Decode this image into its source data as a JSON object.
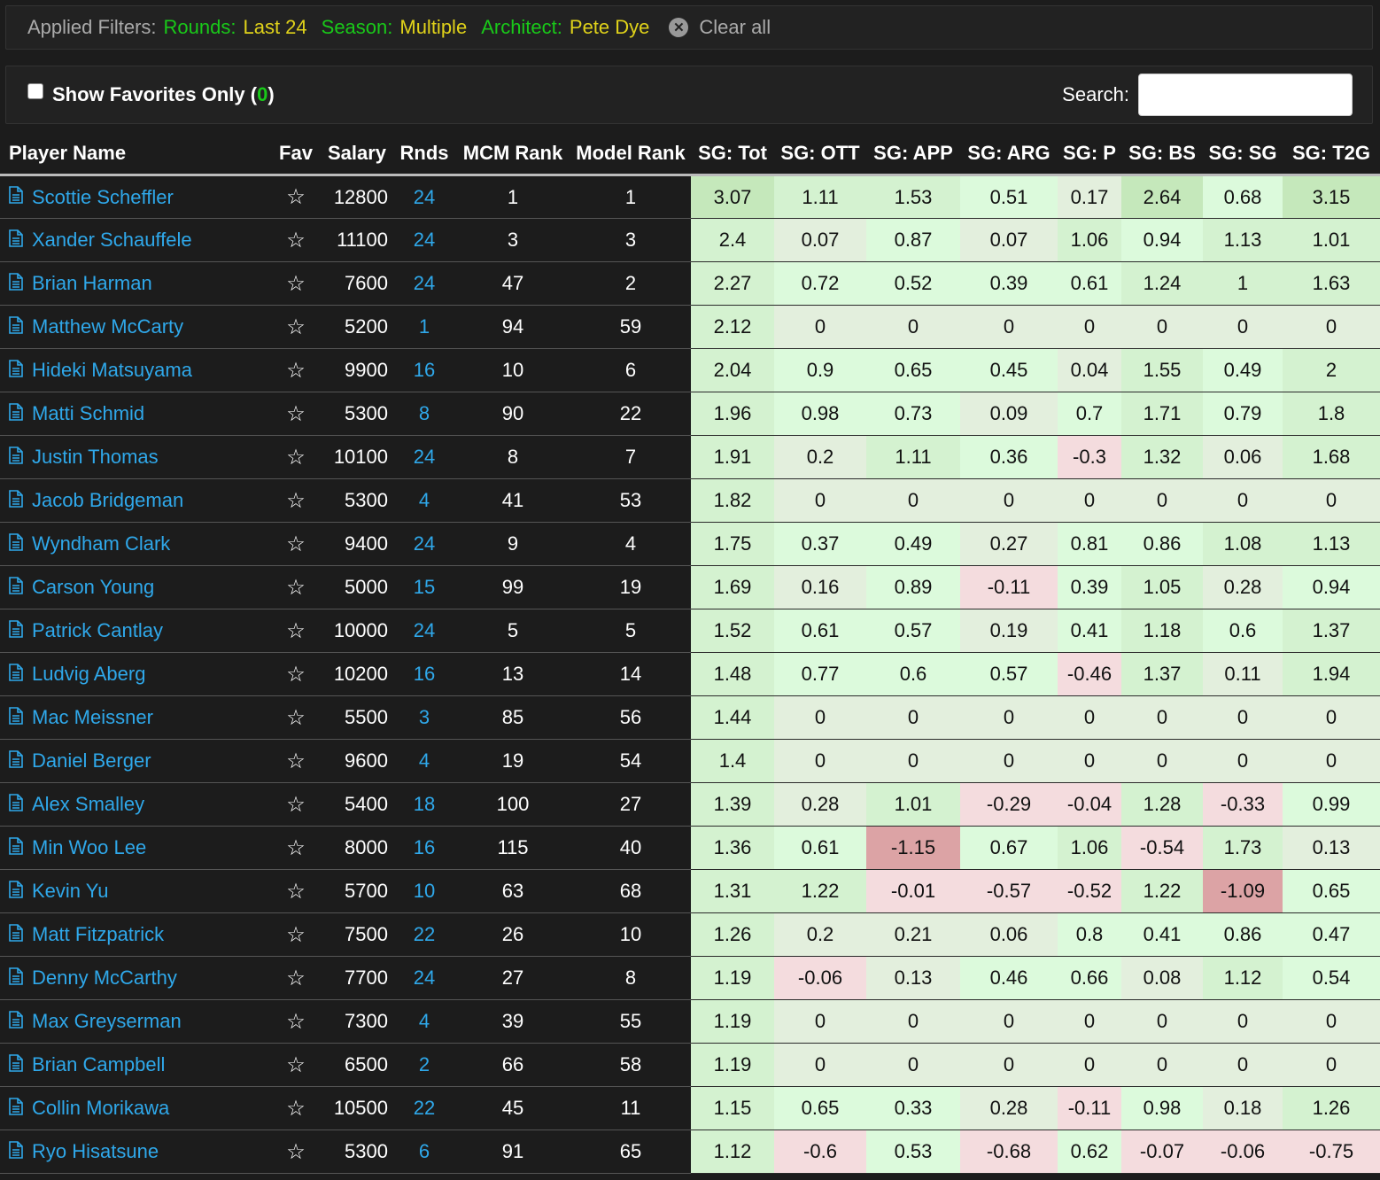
{
  "filters": {
    "label": "Applied Filters:",
    "items": [
      {
        "key": "Rounds:",
        "value": "Last 24"
      },
      {
        "key": "Season:",
        "value": "Multiple"
      },
      {
        "key": "Architect:",
        "value": "Pete Dye"
      }
    ],
    "clear_label": "Clear all"
  },
  "controls": {
    "favorites_label": "Show Favorites Only",
    "favorites_open": "(",
    "favorites_count": "0",
    "favorites_close": ")",
    "search_label": "Search:",
    "search_value": ""
  },
  "columns": [
    "Player Name",
    "Fav",
    "Salary",
    "Rnds",
    "MCM Rank",
    "Model Rank",
    "SG: Tot",
    "SG: OTT",
    "SG: APP",
    "SG: ARG",
    "SG: P",
    "SG: BS",
    "SG: SG",
    "SG: T2G"
  ],
  "icons": {
    "row_doc": "document-icon",
    "favorite": "star-outline-icon",
    "clear": "close-circle-icon"
  },
  "colors": {
    "link_blue": "#2fa8ea",
    "filter_key_green": "#19c919",
    "filter_value_yellow": "#e0d21a",
    "cell_strong_green": "#c5e8bb",
    "cell_mid_green": "#d4f2d0",
    "cell_light_green": "#dcfadc",
    "cell_neutral": "#e3efdd",
    "cell_light_red": "#f4dcde",
    "cell_strong_red": "#dca3a5"
  },
  "rows": [
    {
      "name": "Scottie Scheffler",
      "salary": "12800",
      "rnds": "24",
      "mcm": "1",
      "model": "1",
      "sg": [
        "3.07",
        "1.11",
        "1.53",
        "0.51",
        "0.17",
        "2.64",
        "0.68",
        "3.15"
      ]
    },
    {
      "name": "Xander Schauffele",
      "salary": "11100",
      "rnds": "24",
      "mcm": "3",
      "model": "3",
      "sg": [
        "2.4",
        "0.07",
        "0.87",
        "0.07",
        "1.06",
        "0.94",
        "1.13",
        "1.01"
      ]
    },
    {
      "name": "Brian Harman",
      "salary": "7600",
      "rnds": "24",
      "mcm": "47",
      "model": "2",
      "sg": [
        "2.27",
        "0.72",
        "0.52",
        "0.39",
        "0.61",
        "1.24",
        "1",
        "1.63"
      ]
    },
    {
      "name": "Matthew McCarty",
      "salary": "5200",
      "rnds": "1",
      "mcm": "94",
      "model": "59",
      "sg": [
        "2.12",
        "0",
        "0",
        "0",
        "0",
        "0",
        "0",
        "0"
      ]
    },
    {
      "name": "Hideki Matsuyama",
      "salary": "9900",
      "rnds": "16",
      "mcm": "10",
      "model": "6",
      "sg": [
        "2.04",
        "0.9",
        "0.65",
        "0.45",
        "0.04",
        "1.55",
        "0.49",
        "2"
      ]
    },
    {
      "name": "Matti Schmid",
      "salary": "5300",
      "rnds": "8",
      "mcm": "90",
      "model": "22",
      "sg": [
        "1.96",
        "0.98",
        "0.73",
        "0.09",
        "0.7",
        "1.71",
        "0.79",
        "1.8"
      ]
    },
    {
      "name": "Justin Thomas",
      "salary": "10100",
      "rnds": "24",
      "mcm": "8",
      "model": "7",
      "sg": [
        "1.91",
        "0.2",
        "1.11",
        "0.36",
        "-0.3",
        "1.32",
        "0.06",
        "1.68"
      ]
    },
    {
      "name": "Jacob Bridgeman",
      "salary": "5300",
      "rnds": "4",
      "mcm": "41",
      "model": "53",
      "sg": [
        "1.82",
        "0",
        "0",
        "0",
        "0",
        "0",
        "0",
        "0"
      ]
    },
    {
      "name": "Wyndham Clark",
      "salary": "9400",
      "rnds": "24",
      "mcm": "9",
      "model": "4",
      "sg": [
        "1.75",
        "0.37",
        "0.49",
        "0.27",
        "0.81",
        "0.86",
        "1.08",
        "1.13"
      ]
    },
    {
      "name": "Carson Young",
      "salary": "5000",
      "rnds": "15",
      "mcm": "99",
      "model": "19",
      "sg": [
        "1.69",
        "0.16",
        "0.89",
        "-0.11",
        "0.39",
        "1.05",
        "0.28",
        "0.94"
      ]
    },
    {
      "name": "Patrick Cantlay",
      "salary": "10000",
      "rnds": "24",
      "mcm": "5",
      "model": "5",
      "sg": [
        "1.52",
        "0.61",
        "0.57",
        "0.19",
        "0.41",
        "1.18",
        "0.6",
        "1.37"
      ]
    },
    {
      "name": "Ludvig Aberg",
      "salary": "10200",
      "rnds": "16",
      "mcm": "13",
      "model": "14",
      "sg": [
        "1.48",
        "0.77",
        "0.6",
        "0.57",
        "-0.46",
        "1.37",
        "0.11",
        "1.94"
      ]
    },
    {
      "name": "Mac Meissner",
      "salary": "5500",
      "rnds": "3",
      "mcm": "85",
      "model": "56",
      "sg": [
        "1.44",
        "0",
        "0",
        "0",
        "0",
        "0",
        "0",
        "0"
      ]
    },
    {
      "name": "Daniel Berger",
      "salary": "9600",
      "rnds": "4",
      "mcm": "19",
      "model": "54",
      "sg": [
        "1.4",
        "0",
        "0",
        "0",
        "0",
        "0",
        "0",
        "0"
      ]
    },
    {
      "name": "Alex Smalley",
      "salary": "5400",
      "rnds": "18",
      "mcm": "100",
      "model": "27",
      "sg": [
        "1.39",
        "0.28",
        "1.01",
        "-0.29",
        "-0.04",
        "1.28",
        "-0.33",
        "0.99"
      ]
    },
    {
      "name": "Min Woo Lee",
      "salary": "8000",
      "rnds": "16",
      "mcm": "115",
      "model": "40",
      "sg": [
        "1.36",
        "0.61",
        "-1.15",
        "0.67",
        "1.06",
        "-0.54",
        "1.73",
        "0.13"
      ]
    },
    {
      "name": "Kevin Yu",
      "salary": "5700",
      "rnds": "10",
      "mcm": "63",
      "model": "68",
      "sg": [
        "1.31",
        "1.22",
        "-0.01",
        "-0.57",
        "-0.52",
        "1.22",
        "-1.09",
        "0.65"
      ]
    },
    {
      "name": "Matt Fitzpatrick",
      "salary": "7500",
      "rnds": "22",
      "mcm": "26",
      "model": "10",
      "sg": [
        "1.26",
        "0.2",
        "0.21",
        "0.06",
        "0.8",
        "0.41",
        "0.86",
        "0.47"
      ]
    },
    {
      "name": "Denny McCarthy",
      "salary": "7700",
      "rnds": "24",
      "mcm": "27",
      "model": "8",
      "sg": [
        "1.19",
        "-0.06",
        "0.13",
        "0.46",
        "0.66",
        "0.08",
        "1.12",
        "0.54"
      ]
    },
    {
      "name": "Max Greyserman",
      "salary": "7300",
      "rnds": "4",
      "mcm": "39",
      "model": "55",
      "sg": [
        "1.19",
        "0",
        "0",
        "0",
        "0",
        "0",
        "0",
        "0"
      ]
    },
    {
      "name": "Brian Campbell",
      "salary": "6500",
      "rnds": "2",
      "mcm": "66",
      "model": "58",
      "sg": [
        "1.19",
        "0",
        "0",
        "0",
        "0",
        "0",
        "0",
        "0"
      ]
    },
    {
      "name": "Collin Morikawa",
      "salary": "10500",
      "rnds": "22",
      "mcm": "45",
      "model": "11",
      "sg": [
        "1.15",
        "0.65",
        "0.33",
        "0.28",
        "-0.11",
        "0.98",
        "0.18",
        "1.26"
      ]
    },
    {
      "name": "Ryo Hisatsune",
      "salary": "5300",
      "rnds": "6",
      "mcm": "91",
      "model": "65",
      "sg": [
        "1.12",
        "-0.6",
        "0.53",
        "-0.68",
        "0.62",
        "-0.07",
        "-0.06",
        "-0.75"
      ]
    }
  ]
}
